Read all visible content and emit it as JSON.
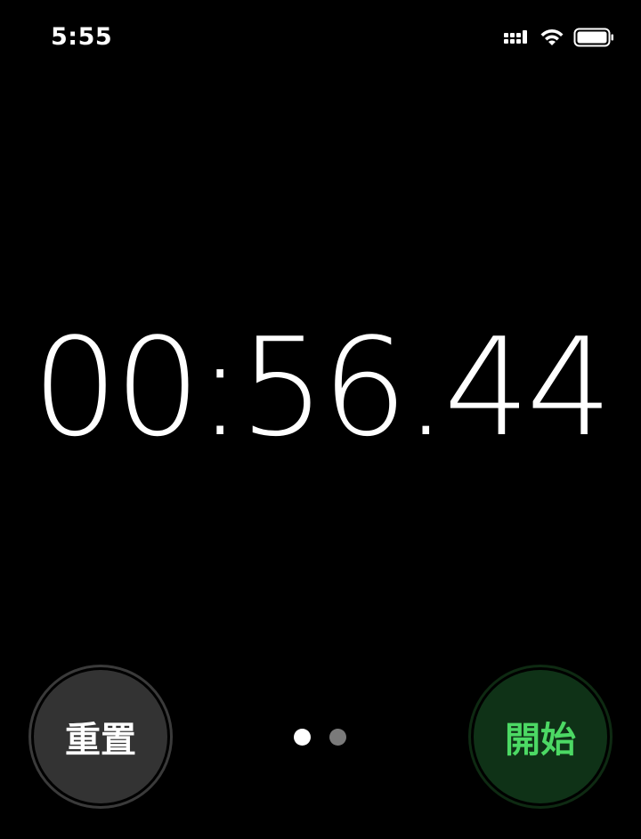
{
  "status_bar": {
    "time": "5:55",
    "icons": [
      "cellular-signal-icon",
      "wifi-icon",
      "battery-icon"
    ]
  },
  "stopwatch": {
    "display": "00:56.44"
  },
  "buttons": {
    "reset_label": "重置",
    "start_label": "開始"
  },
  "pager": {
    "pages": 2,
    "current_index": 0
  },
  "colors": {
    "background": "#000000",
    "start_text": "#4cd964",
    "start_fill": "#0f3217",
    "reset_fill": "#333333"
  }
}
